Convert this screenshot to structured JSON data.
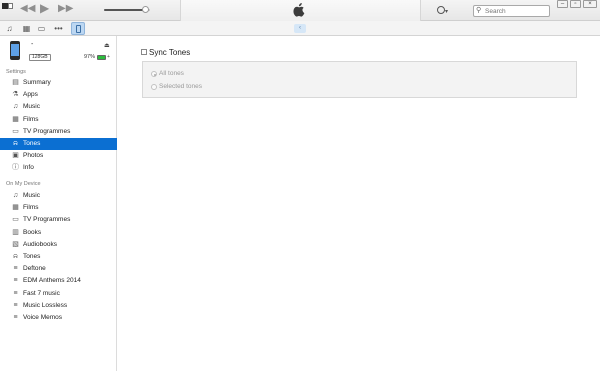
{
  "toolbar": {
    "search_placeholder": "Search",
    "account_label": "▾",
    "volume_level": 0.9
  },
  "subbar": {
    "icons": [
      "music-icon",
      "films-icon",
      "tv-icon",
      "more-icon",
      "iphone-icon"
    ],
    "more_label": "•••",
    "back_label": "‹"
  },
  "device": {
    "name": "-",
    "capacity": "128GB",
    "battery_pct": "97%",
    "battery_level": 0.97
  },
  "sidebar": {
    "settings_label": "Settings",
    "settings_items": [
      {
        "label": "Summary",
        "icon": "summary-icon"
      },
      {
        "label": "Apps",
        "icon": "apps-icon"
      },
      {
        "label": "Music",
        "icon": "music-icon"
      },
      {
        "label": "Films",
        "icon": "films-icon"
      },
      {
        "label": "TV Programmes",
        "icon": "tv-icon"
      },
      {
        "label": "Tones",
        "icon": "bell-icon",
        "selected": true
      },
      {
        "label": "Photos",
        "icon": "camera-icon"
      },
      {
        "label": "Info",
        "icon": "info-icon"
      }
    ],
    "ondevice_label": "On My Device",
    "ondevice_items": [
      {
        "label": "Music",
        "icon": "music-icon"
      },
      {
        "label": "Films",
        "icon": "films-icon"
      },
      {
        "label": "TV Programmes",
        "icon": "tv-icon"
      },
      {
        "label": "Books",
        "icon": "books-icon"
      },
      {
        "label": "Audiobooks",
        "icon": "audiobook-icon"
      },
      {
        "label": "Tones",
        "icon": "bell-icon"
      },
      {
        "label": "Deftone",
        "icon": "playlist-icon"
      },
      {
        "label": "EDM Anthems 2014",
        "icon": "playlist-icon"
      },
      {
        "label": "Fast 7 music",
        "icon": "playlist-icon"
      },
      {
        "label": "Music Lossless",
        "icon": "playlist-icon"
      },
      {
        "label": "Voice Memos",
        "icon": "playlist-icon"
      }
    ]
  },
  "main": {
    "sync_label": "Sync Tones",
    "options": [
      {
        "label": "All tones",
        "selected": true
      },
      {
        "label": "Selected tones",
        "selected": false
      }
    ]
  }
}
